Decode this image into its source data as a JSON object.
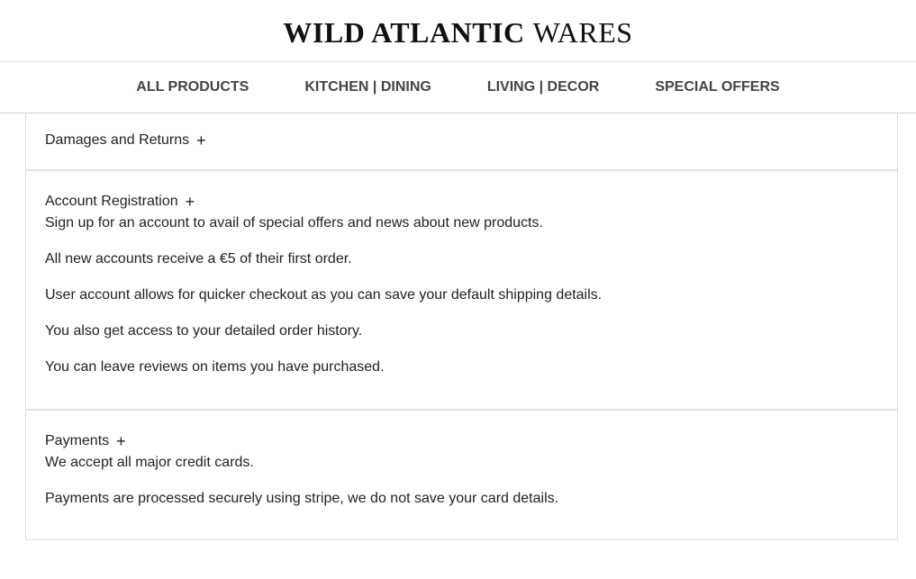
{
  "header": {
    "brand_bold": "WILD ATLANTIC",
    "brand_light": "WARES"
  },
  "nav": {
    "items": [
      {
        "label": "ALL PRODUCTS"
      },
      {
        "label": "KITCHEN | DINING"
      },
      {
        "label": "LIVING | DECOR"
      },
      {
        "label": "SPECIAL OFFERS"
      }
    ]
  },
  "sections": [
    {
      "title": "Damages and Returns",
      "toggle": "+",
      "paragraphs": []
    },
    {
      "title": "Account Registration",
      "toggle": "+",
      "paragraphs": [
        "Sign up for an account to avail of special offers and news about new products.",
        "All new accounts receive a €5 of their first order.",
        "User account allows for quicker checkout as you can save your default shipping details.",
        "You also get access to your detailed order history.",
        "You can leave reviews on items you have purchased."
      ]
    },
    {
      "title": "Payments",
      "toggle": "+",
      "paragraphs": [
        "We accept all major credit cards.",
        "Payments are processed securely using stripe, we do not save your card details."
      ]
    }
  ]
}
